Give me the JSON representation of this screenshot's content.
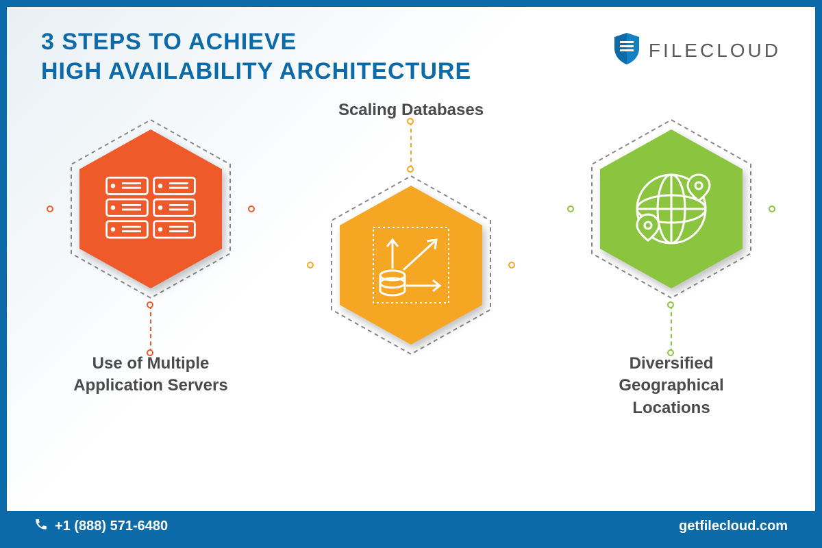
{
  "header": {
    "title_line1": "3 STEPS TO ACHIEVE",
    "title_line2": "HIGH AVAILABILITY ARCHITECTURE",
    "brand": "FILECLOUD"
  },
  "steps": [
    {
      "label": "Use of Multiple Application Servers",
      "color": "#ee5a2a",
      "icon": "servers-icon"
    },
    {
      "label": "Scaling Databases",
      "color": "#f5a623",
      "icon": "scale-database-icon"
    },
    {
      "label": "Diversified Geographical Locations",
      "color": "#8bc53f",
      "icon": "globe-pins-icon"
    }
  ],
  "footer": {
    "phone": "+1 (888) 571-6480",
    "url": "getfilecloud.com"
  }
}
